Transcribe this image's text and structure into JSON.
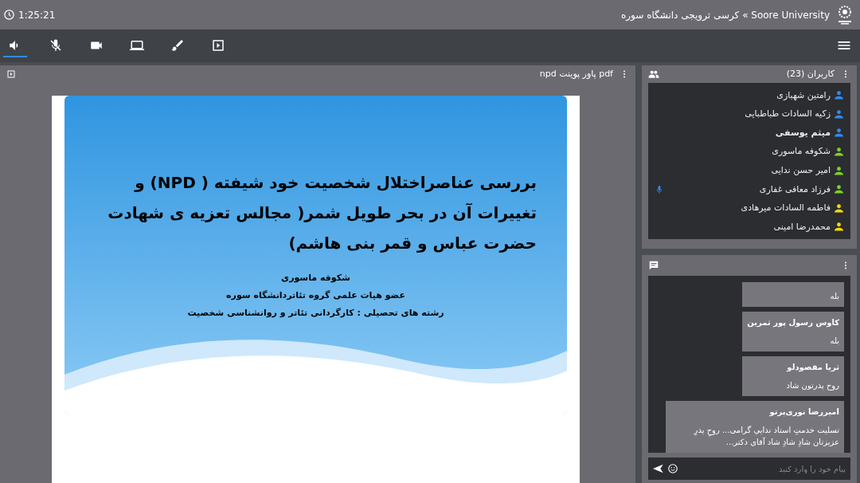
{
  "top_bar": {
    "timer": "1:25:21",
    "title": "Soore University » کرسی ترویجی دانشگاه سوره"
  },
  "toolbar": [
    {
      "kind": "speaker",
      "selected": true
    },
    {
      "kind": "mic-off",
      "selected": false
    },
    {
      "kind": "camera",
      "selected": false
    },
    {
      "kind": "screen",
      "selected": false
    },
    {
      "kind": "brush",
      "selected": false
    },
    {
      "kind": "play",
      "selected": false
    }
  ],
  "presentation": {
    "title": "pdf پاور پوینت npd",
    "slide": {
      "title_lines": [
        "بررسی  عناصراختلال  شخصیت خود شیفته ( NPD) و",
        "تغییرات آن در بحر طویل شمر( مجالس تعزیه ی شهادت",
        "حضرت عباس و قمر بنی هاشم)"
      ],
      "subtitle_lines": [
        "شکوفه ماسوری",
        "عضو هیات علمی گروه تئاتردانشگاه سوره",
        "رشته های تحصیلی : کارگردانی تئاتر و روانشناسی شخصیت"
      ]
    }
  },
  "users": {
    "title": "کاربران (23)",
    "items": [
      {
        "name": "رامتین شهبازی",
        "color": "#2d8cf0",
        "is_self": false,
        "talking": false
      },
      {
        "name": "زکیه السادات طباطبایی",
        "color": "#2d8cf0",
        "is_self": false,
        "talking": false
      },
      {
        "name": "میثم یوسفی",
        "color": "#2d8cf0",
        "is_self": true,
        "talking": false
      },
      {
        "name": "شکوفه ماسوری",
        "color": "#7ed321",
        "is_self": false,
        "talking": false
      },
      {
        "name": "امیر حسن ندایی",
        "color": "#7ed321",
        "is_self": false,
        "talking": false
      },
      {
        "name": "فرزاد معافی غفاری",
        "color": "#7ed321",
        "is_self": false,
        "talking": true
      },
      {
        "name": "فاطمه السادات میرهادی",
        "color": "#f5d90a",
        "is_self": false,
        "talking": false
      },
      {
        "name": "محمدرضا امینی",
        "color": "#f5d90a",
        "is_self": false,
        "talking": false
      }
    ]
  },
  "chat": {
    "messages": [
      {
        "text": "بله"
      },
      {
        "sender": "کاوس رسول پور ثمرین",
        "text": "بله"
      },
      {
        "sender": "ثریا مقصودلو",
        "text": "روح پدرتون شاد"
      },
      {
        "sender": "امیررضا نوری‌پرتو",
        "text": "تسلیت خدمتِ استاد ندایي گرامی... روحِ پدرِ عزیزتان شادِ شادِ شاد آقای دکتر..."
      }
    ],
    "input": {
      "placeholder": "پیام خود را وارد کنید"
    }
  }
}
